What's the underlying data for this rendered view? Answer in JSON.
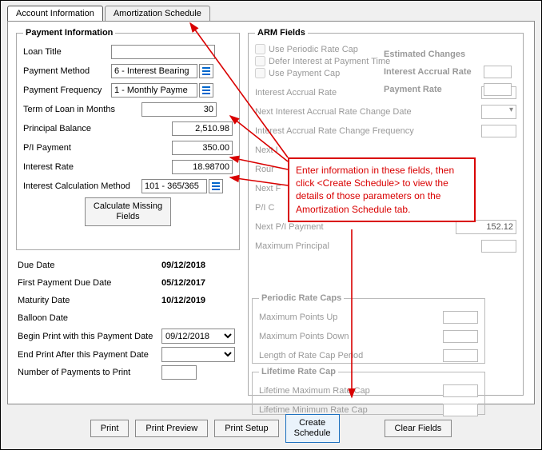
{
  "tabs": {
    "account_info": "Account Information",
    "amort_sched": "Amortization Schedule"
  },
  "payment": {
    "legend": "Payment Information",
    "loan_title_lbl": "Loan Title",
    "loan_title_val": "",
    "payment_method_lbl": "Payment Method",
    "payment_method_val": "6 - Interest Bearing",
    "payment_freq_lbl": "Payment Frequency",
    "payment_freq_val": "1 - Monthly Payme",
    "term_lbl": "Term of Loan in Months",
    "term_val": "30",
    "principal_lbl": "Principal Balance",
    "principal_val": "2,510.98",
    "pi_lbl": "P/I Payment",
    "pi_val": "350.00",
    "interest_rate_lbl": "Interest Rate",
    "interest_rate_val": "18.98700",
    "calc_method_lbl": "Interest Calculation Method",
    "calc_method_val": "101 - 365/365",
    "calc_missing_btn": "Calculate Missing\nFields"
  },
  "dates": {
    "due_date_lbl": "Due Date",
    "due_date_val": "09/12/2018",
    "first_pay_lbl": "First Payment Due Date",
    "first_pay_val": "05/12/2017",
    "maturity_lbl": "Maturity Date",
    "maturity_val": "10/12/2019",
    "balloon_lbl": "Balloon Date",
    "begin_print_lbl": "Begin Print with this Payment Date",
    "begin_print_val": "09/12/2018",
    "end_print_lbl": "End Print After this Payment Date",
    "end_print_val": "",
    "num_payments_lbl": "Number of Payments to Print",
    "num_payments_val": ""
  },
  "arm": {
    "legend": "ARM Fields",
    "use_periodic_lbl": "Use Periodic Rate Cap",
    "defer_lbl": "Defer Interest at Payment Time",
    "use_payment_cap_lbl": "Use Payment Cap",
    "estimated_changes": "Estimated Changes",
    "interest_accrual_rate": "Interest Accrual Rate",
    "payment_rate": "Payment Rate",
    "iar_lbl": "Interest Accrual Rate",
    "next_iar_change_lbl": "Next Interest Accrual Rate Change Date",
    "iar_change_freq_lbl": "Interest Accrual Rate Change Frequency",
    "next_rate_lbl": "Next I",
    "rounding_lbl": "Rour",
    "next_payment_change_lbl": "Next F",
    "pi_change_freq_lbl": "P/I C",
    "next_pi_lbl": "Next P/I Payment",
    "next_pi_val": "152.12",
    "max_principal_lbl": "Maximum Principal",
    "prc_legend": "Periodic Rate Caps",
    "max_pts_up_lbl": "Maximum Points Up",
    "max_pts_down_lbl": "Maximum Points Down",
    "len_rate_cap_lbl": "Length of Rate Cap Period",
    "lrc_legend": "Lifetime Rate Cap",
    "life_max_lbl": "Lifetime Maximum Rate Cap",
    "life_min_lbl": "Lifetime Minimum Rate Cap"
  },
  "buttons": {
    "print": "Print",
    "preview": "Print Preview",
    "setup": "Print Setup",
    "create": "Create\nSchedule",
    "clear": "Clear Fields"
  },
  "callout": {
    "text": "Enter information in these fields, then click <Create Schedule> to view the details of those parameters on the Amortization Schedule tab."
  }
}
